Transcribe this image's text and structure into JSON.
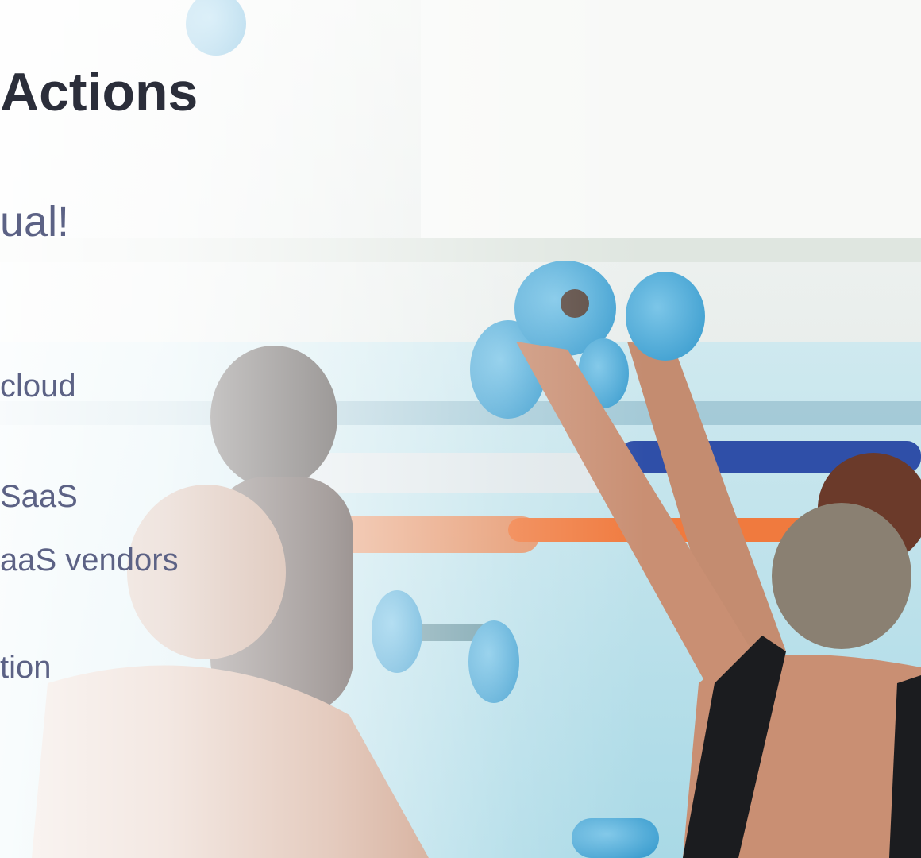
{
  "slide": {
    "title": "Actions",
    "subtitle": "ual!",
    "bullets": [
      "cloud",
      "SaaS",
      "aaS vendors",
      "tion"
    ]
  },
  "photo": {
    "subject": "aqua-fitness-class-photo",
    "colors": {
      "water": "#9fd4e4",
      "dumbbell": "#4aaad6",
      "skin": "#c98f73",
      "hair": "#8a8072",
      "swimsuit": "#1b1c1f",
      "lane_rope_blue": "#2f4fa8",
      "noodle_orange": "#f07a3e"
    }
  }
}
